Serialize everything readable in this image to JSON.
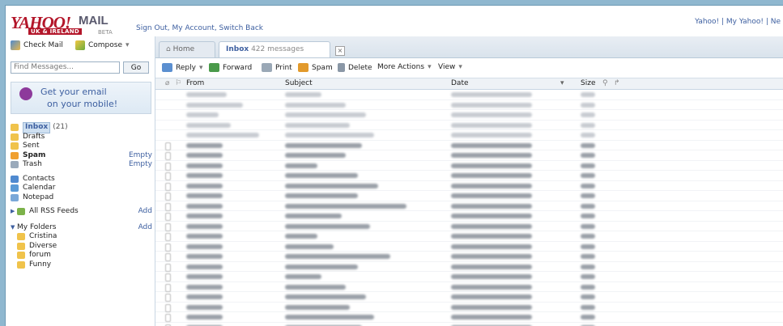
{
  "header": {
    "logo_text": "YAHOO!",
    "mail_text": "MAIL",
    "region_text": "UK & IRELAND",
    "beta_text": "BETA",
    "links": "Sign Out, My Account, Switch Back",
    "top_right_links": "Yahoo! | My Yahoo! | Ne"
  },
  "sidebar": {
    "check_mail": "Check Mail",
    "compose": "Compose",
    "search_placeholder": "Find Messages...",
    "go": "Go",
    "promo_line1": "Get your email",
    "promo_line2": "on your mobile!",
    "folders": [
      {
        "name": "Inbox",
        "count": "(21)"
      },
      {
        "name": "Drafts"
      },
      {
        "name": "Sent"
      },
      {
        "name": "Spam",
        "action": "Empty"
      },
      {
        "name": "Trash",
        "action": "Empty"
      },
      {
        "name": "Contacts"
      },
      {
        "name": "Calendar"
      },
      {
        "name": "Notepad"
      },
      {
        "name": "All RSS Feeds",
        "action": "Add"
      },
      {
        "name": "My Folders",
        "action": "Add"
      },
      {
        "name": "Cristina"
      },
      {
        "name": "Diverse"
      },
      {
        "name": "forum"
      },
      {
        "name": "Funny"
      }
    ]
  },
  "tabs": {
    "home": "Home",
    "inbox": "Inbox",
    "inbox_count": "422 messages",
    "close": "×"
  },
  "toolbar": {
    "reply": "Reply",
    "forward": "Forward",
    "print": "Print",
    "spam": "Spam",
    "delete": "Delete",
    "more_actions": "More Actions",
    "view": "View"
  },
  "columns": {
    "from": "From",
    "subject": "Subject",
    "date": "Date",
    "size": "Size"
  },
  "colors": {
    "yahoo_red": "#b3162a",
    "link_blue": "#3d5fa0",
    "background_blue": "#8fb7cf"
  }
}
